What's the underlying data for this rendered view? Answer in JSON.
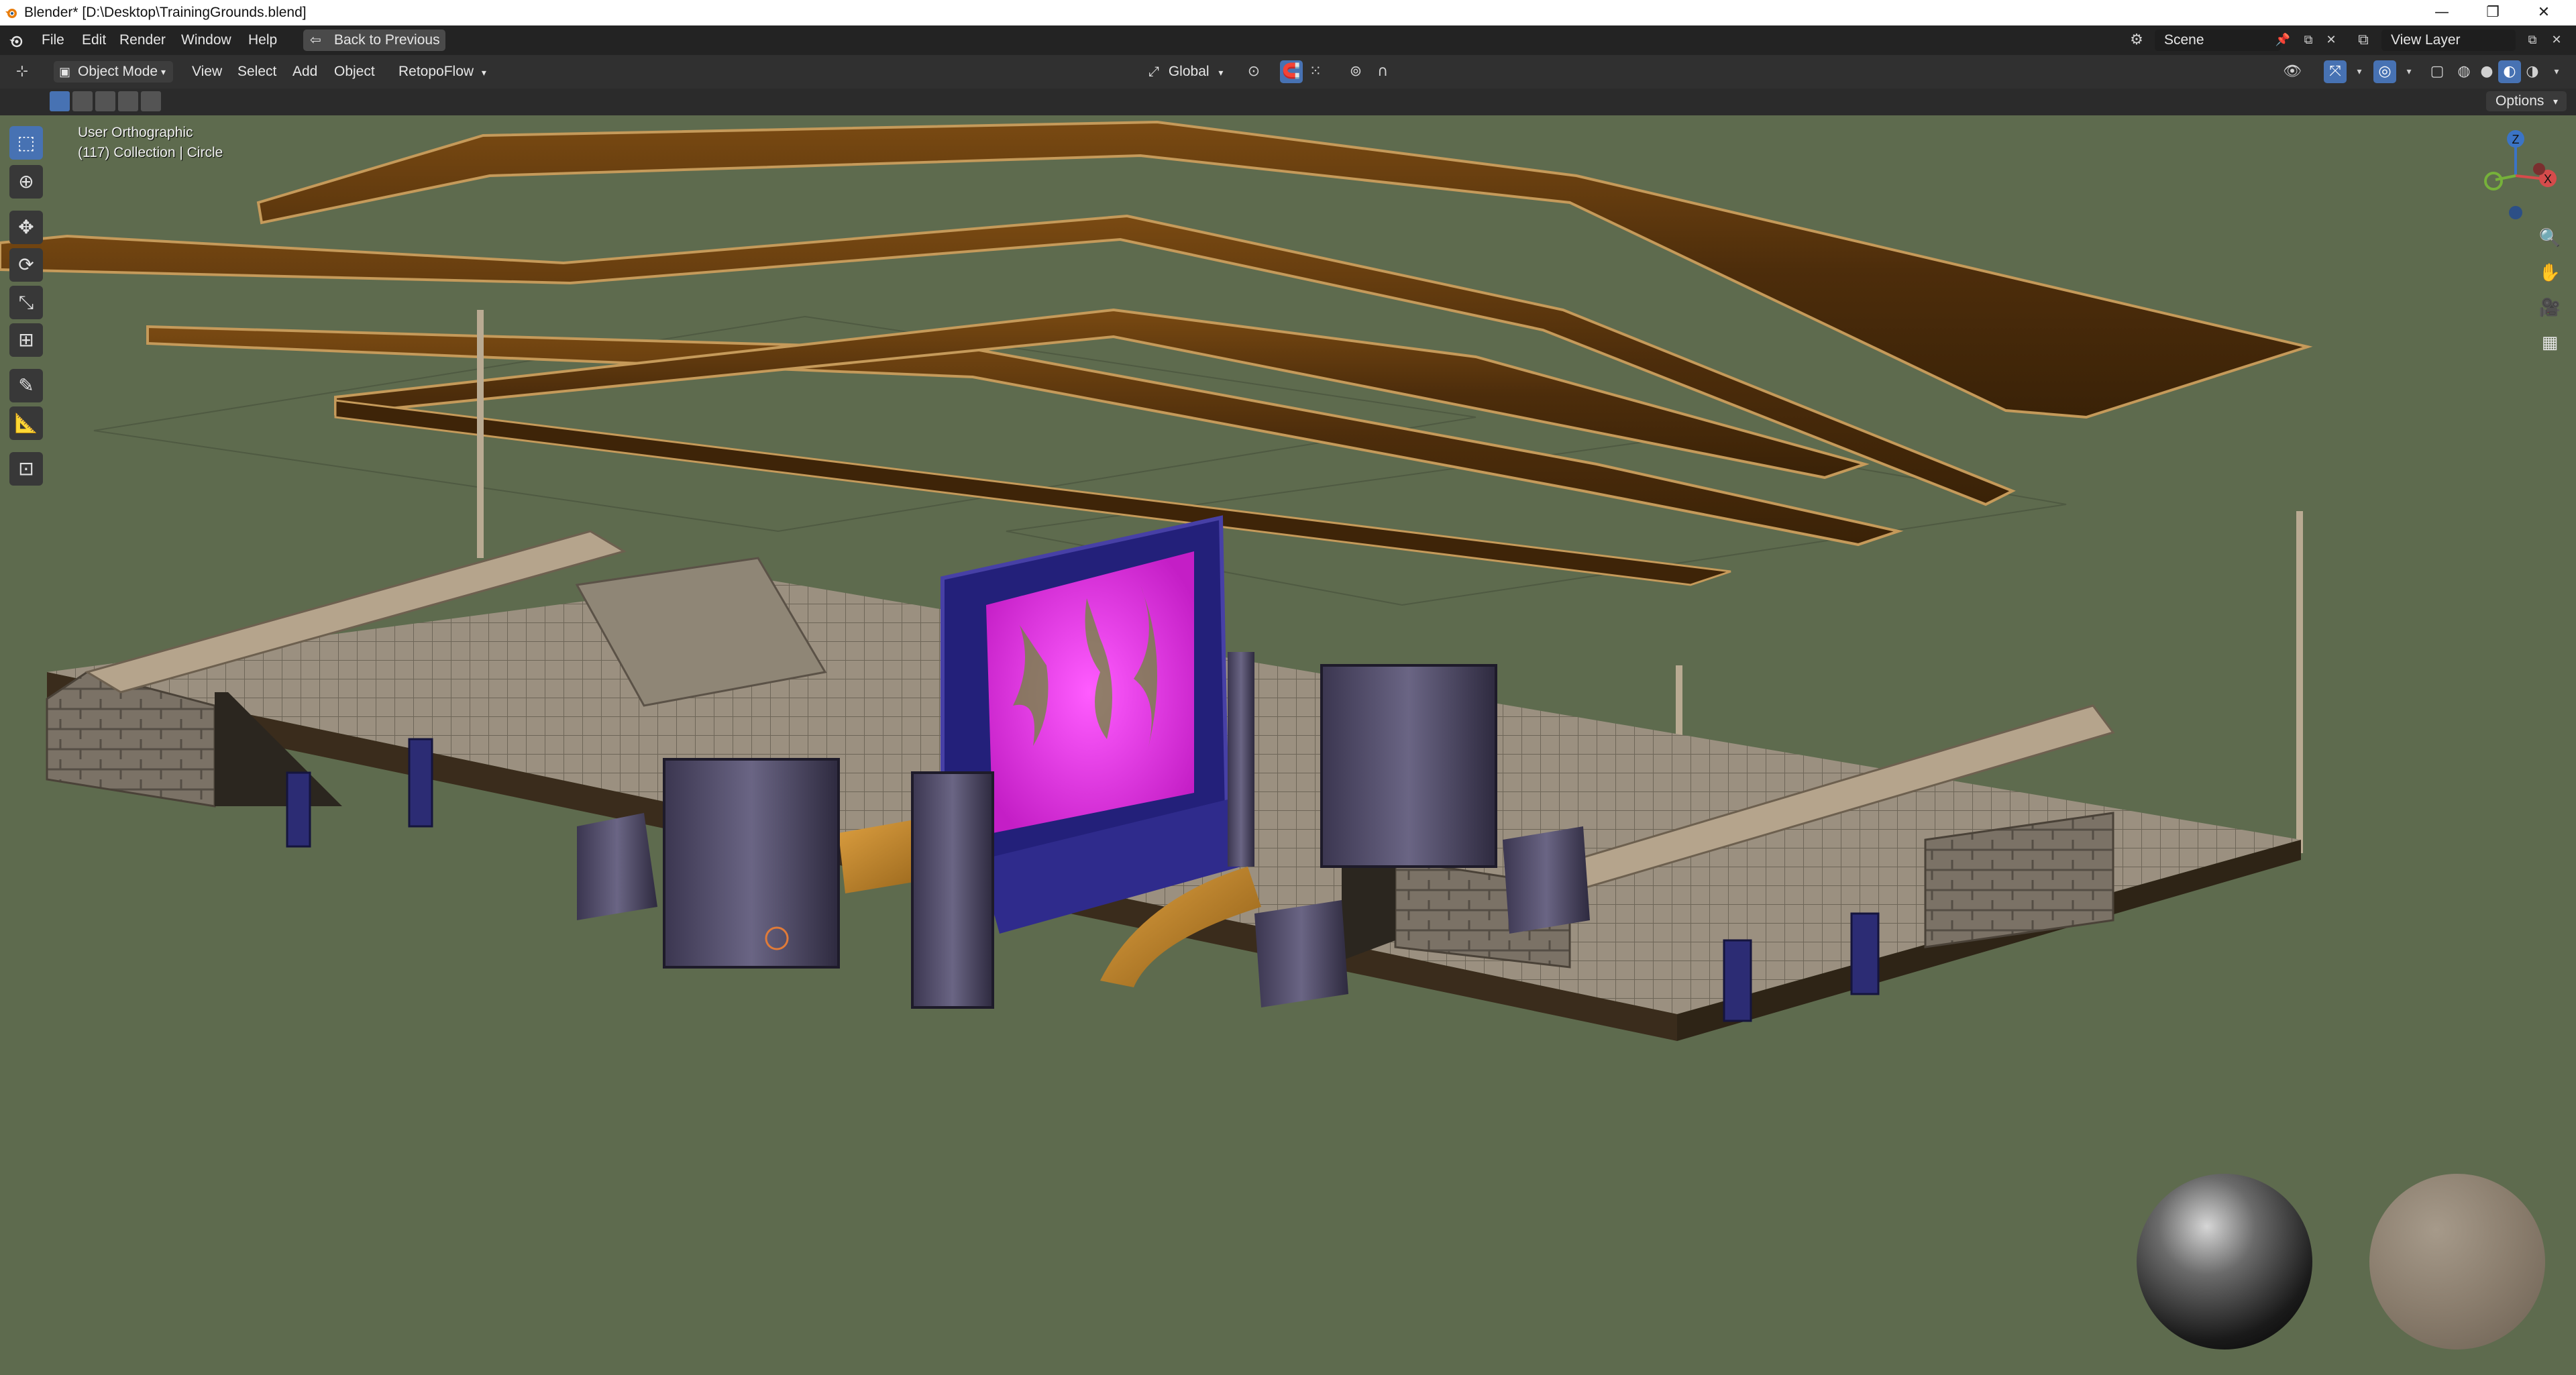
{
  "window": {
    "title": "Blender* [D:\\Desktop\\TrainingGrounds.blend]",
    "minimize": "—",
    "restore": "❐",
    "close": "✕"
  },
  "topbar": {
    "menus": [
      "File",
      "Edit",
      "Render",
      "Window",
      "Help"
    ],
    "back_button": "Back to Previous",
    "scene_label": "Scene",
    "view_layer_label": "View Layer"
  },
  "header": {
    "mode": "Object Mode",
    "menus": [
      "View",
      "Select",
      "Add",
      "Object"
    ],
    "addon_menu": "RetopoFlow",
    "transform_orientation": "Global",
    "options": "Options"
  },
  "viewport": {
    "view_name": "User Orthographic",
    "collection_info": "(117) Collection | Circle",
    "gizmo_axes": {
      "z": "Z",
      "x": "X"
    }
  },
  "icons": {
    "app": "blender-logo-icon",
    "back": "back-arrow-icon",
    "select": "select-box-icon",
    "cursor": "cursor-icon",
    "move": "move-icon",
    "rotate": "rotate-icon",
    "scale": "scale-icon",
    "transform": "transform-icon",
    "annotate": "annotate-icon",
    "measure": "measure-icon",
    "add_cube": "add-cube-icon",
    "zoom": "zoom-icon",
    "pan": "hand-icon",
    "camera": "camera-icon",
    "grid": "grid-icon"
  },
  "colors": {
    "accent": "#4772b3",
    "viewport_bg": "#5e6b4e",
    "header_bg": "#303030",
    "screen_pink": "#e83ce6"
  }
}
